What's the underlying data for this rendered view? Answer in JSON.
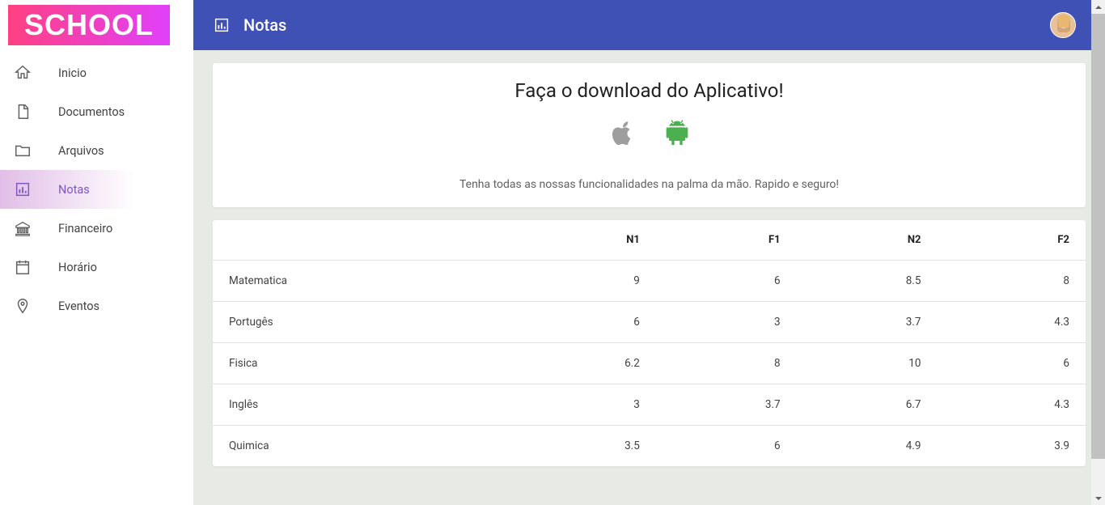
{
  "logo": "SCHOOL",
  "sidebar": {
    "items": [
      {
        "label": "Inicio",
        "icon": "home",
        "active": false
      },
      {
        "label": "Documentos",
        "icon": "doc",
        "active": false
      },
      {
        "label": "Arquivos",
        "icon": "folder",
        "active": false
      },
      {
        "label": "Notas",
        "icon": "chart",
        "active": true
      },
      {
        "label": "Financeiro",
        "icon": "bank",
        "active": false
      },
      {
        "label": "Horário",
        "icon": "calendar",
        "active": false
      },
      {
        "label": "Eventos",
        "icon": "pin",
        "active": false
      }
    ]
  },
  "header": {
    "title": "Notas"
  },
  "download_card": {
    "title": "Faça o download do Aplicativo!",
    "subtitle": "Tenha todas as nossas funcionalidades na palma da mão. Rapido e seguro!"
  },
  "grades_table": {
    "headers": [
      "",
      "N1",
      "F1",
      "N2",
      "F2"
    ],
    "rows": [
      {
        "subject": "Matematica",
        "n1": "9",
        "f1": "6",
        "n2": "8.5",
        "f2": "8"
      },
      {
        "subject": "Portugês",
        "n1": "6",
        "f1": "3",
        "n2": "3.7",
        "f2": "4.3"
      },
      {
        "subject": "Fisica",
        "n1": "6.2",
        "f1": "8",
        "n2": "10",
        "f2": "6"
      },
      {
        "subject": "Inglês",
        "n1": "3",
        "f1": "3.7",
        "n2": "6.7",
        "f2": "4.3"
      },
      {
        "subject": "Quimica",
        "n1": "3.5",
        "f1": "6",
        "n2": "4.9",
        "f2": "3.9"
      }
    ]
  }
}
